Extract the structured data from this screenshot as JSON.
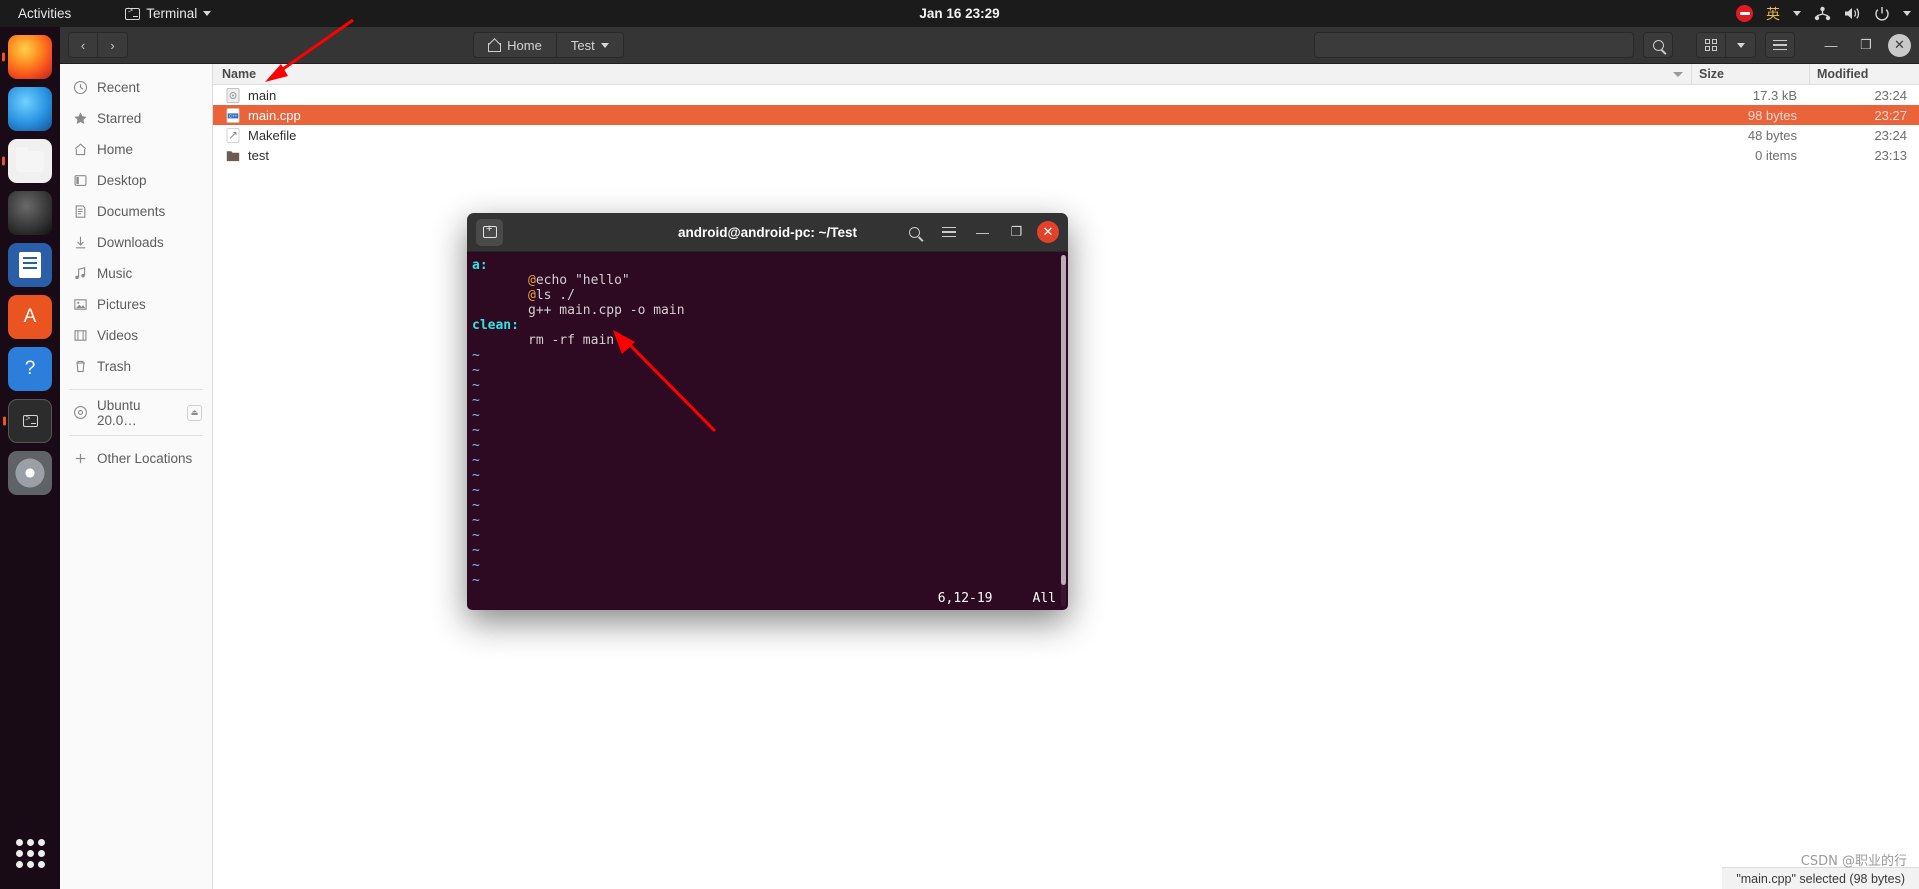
{
  "topbar": {
    "activities": "Activities",
    "app_name": "Terminal",
    "app_icon": "terminal-icon",
    "clock": "Jan 16  23:29",
    "tray": {
      "dnd_icon": "do-not-disturb-icon",
      "input_method": "英",
      "network_icon": "network-icon",
      "volume_icon": "volume-icon",
      "power_icon": "power-icon",
      "menu_icon": "chevron-down-icon"
    }
  },
  "dock": {
    "items": [
      {
        "name": "firefox",
        "label": "Firefox",
        "glyph": ""
      },
      {
        "name": "thunderbird",
        "label": "Thunderbird",
        "glyph": ""
      },
      {
        "name": "files",
        "label": "Files",
        "glyph": ""
      },
      {
        "name": "rhythmbox",
        "label": "Rhythmbox",
        "glyph": ""
      },
      {
        "name": "libreoffice-writer",
        "label": "LibreOffice Writer",
        "glyph": ""
      },
      {
        "name": "ubuntu-software",
        "label": "Ubuntu Software",
        "glyph": "A"
      },
      {
        "name": "help",
        "label": "Help",
        "glyph": "?"
      },
      {
        "name": "terminal",
        "label": "Terminal",
        "glyph": ""
      },
      {
        "name": "dvd",
        "label": "DVD",
        "glyph": ""
      }
    ],
    "show_apps": "Show Applications"
  },
  "files_window": {
    "nav": {
      "back": "‹",
      "forward": "›"
    },
    "breadcrumbs": [
      {
        "label": "Home",
        "icon": "home-icon"
      },
      {
        "label": "Test",
        "icon": "chevron-down-icon"
      }
    ],
    "search_placeholder": "",
    "search_icon": "search-icon",
    "view_grid_icon": "grid-view-icon",
    "view_dropdown_icon": "chevron-down-icon",
    "menu_icon": "hamburger-menu-icon",
    "minimize": "—",
    "maximize": "❐",
    "close": "✕",
    "sidebar": [
      {
        "label": "Recent",
        "icon": "clock-icon"
      },
      {
        "label": "Starred",
        "icon": "star-icon"
      },
      {
        "label": "Home",
        "icon": "home-icon"
      },
      {
        "label": "Desktop",
        "icon": "desktop-icon"
      },
      {
        "label": "Documents",
        "icon": "documents-icon"
      },
      {
        "label": "Downloads",
        "icon": "download-icon"
      },
      {
        "label": "Music",
        "icon": "music-icon"
      },
      {
        "label": "Pictures",
        "icon": "pictures-icon"
      },
      {
        "label": "Videos",
        "icon": "videos-icon"
      },
      {
        "label": "Trash",
        "icon": "trash-icon"
      }
    ],
    "devices": [
      {
        "label": "Ubuntu 20.0…",
        "icon": "disc-icon",
        "eject": "⏏"
      }
    ],
    "other": {
      "label": "Other Locations",
      "icon": "plus-icon"
    },
    "columns": {
      "name": "Name",
      "size": "Size",
      "modified": "Modified"
    },
    "rows": [
      {
        "name": "main",
        "size": "17.3 kB",
        "modified": "23:24",
        "icon": "executable-icon",
        "selected": false
      },
      {
        "name": "main.cpp",
        "size": "98 bytes",
        "modified": "23:27",
        "icon": "cpp-file-icon",
        "selected": true
      },
      {
        "name": "Makefile",
        "size": "48 bytes",
        "modified": "23:24",
        "icon": "text-file-icon",
        "selected": false
      },
      {
        "name": "test",
        "size": "0 items",
        "modified": "23:13",
        "icon": "folder-icon",
        "selected": false
      }
    ],
    "status": "\"main.cpp\" selected (98 bytes)"
  },
  "terminal_window": {
    "title": "android@android-pc: ~/Test",
    "new_tab_icon": "new-tab-icon",
    "search_icon": "search-icon",
    "menu_icon": "hamburger-menu-icon",
    "minimize": "—",
    "maximize": "❐",
    "close": "✕",
    "content_lines": [
      {
        "type": "target",
        "text": "a:"
      },
      {
        "type": "recipe_at",
        "at": "@",
        "text": "echo \"hello\""
      },
      {
        "type": "recipe_at",
        "at": "@",
        "text": "ls ./"
      },
      {
        "type": "recipe",
        "text": "g++ main.cpp -o main"
      },
      {
        "type": "target",
        "text": "clean:"
      },
      {
        "type": "recipe",
        "text": "rm -rf main"
      }
    ],
    "empty_marker": "~",
    "empty_line_count": 16,
    "status_position": "6,12-19",
    "status_scroll": "All"
  },
  "watermark": "CSDN @职业的行",
  "annotations": {
    "arrow_color": "#ff0000",
    "arrow_1": "points-to-name-column-header",
    "arrow_2": "points-to-rm-rf-main-line"
  }
}
